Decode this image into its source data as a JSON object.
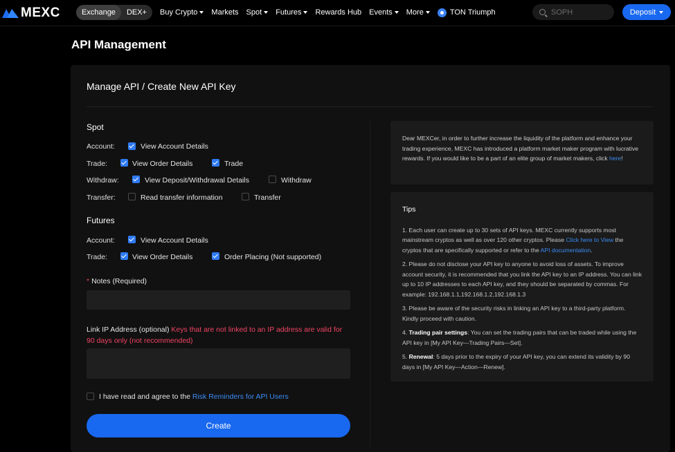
{
  "nav": {
    "logo": "MEXC",
    "switch": [
      "Exchange",
      "DEX+"
    ],
    "menu": [
      {
        "label": "Buy Crypto",
        "caret": true
      },
      {
        "label": "Markets",
        "caret": false
      },
      {
        "label": "Spot",
        "caret": true
      },
      {
        "label": "Futures",
        "caret": true
      },
      {
        "label": "Rewards Hub",
        "caret": false
      },
      {
        "label": "Events",
        "caret": true
      },
      {
        "label": "More",
        "caret": true
      }
    ],
    "promo": "TON Triumph",
    "search_placeholder": "SOPH",
    "deposit": "Deposit"
  },
  "page_title": "API Management",
  "panel_title": "Manage API / Create New API Key",
  "spot": {
    "title": "Spot",
    "rows": [
      {
        "label": "Account:",
        "options": [
          {
            "label": "View Account Details",
            "checked": true
          }
        ]
      },
      {
        "label": "Trade:",
        "options": [
          {
            "label": "View Order Details",
            "checked": true
          },
          {
            "label": "Trade",
            "checked": true
          }
        ]
      },
      {
        "label": "Withdraw:",
        "options": [
          {
            "label": "View Deposit/Withdrawal Details",
            "checked": true
          },
          {
            "label": "Withdraw",
            "checked": false
          }
        ]
      },
      {
        "label": "Transfer:",
        "options": [
          {
            "label": "Read transfer information",
            "checked": false
          },
          {
            "label": "Transfer",
            "checked": false
          }
        ]
      }
    ]
  },
  "futures": {
    "title": "Futures",
    "rows": [
      {
        "label": "Account:",
        "options": [
          {
            "label": "View Account Details",
            "checked": true
          }
        ]
      },
      {
        "label": "Trade:",
        "options": [
          {
            "label": "View Order Details",
            "checked": true
          },
          {
            "label": "Order Placing (Not supported)",
            "checked": true
          }
        ]
      }
    ]
  },
  "notes": {
    "required_mark": "*",
    "label": "Notes (Required)",
    "value": ""
  },
  "ip": {
    "label": "Link IP Address (optional)",
    "warning_line1": "Keys that are not linked to an IP address are valid for",
    "warning_line2": "90 days only (not recommended)",
    "value": ""
  },
  "agree": {
    "text": "I have read and agree to the",
    "link": "Risk Reminders for API Users",
    "checked": false
  },
  "create": "Create",
  "notice": {
    "text": "Dear MEXCer, in order to further increase the liquidity of the platform and enhance your trading experience, MEXC has introduced a platform market maker program with lucrative rewards. If you would like to be a part of an elite group of market makers, click ",
    "link": "here",
    "end": "!"
  },
  "tips": {
    "title": "Tips",
    "t1_a": "1. Each user can create up to 30 sets of API keys. MEXC currently supports most mainstream cryptos as well as over 120 other cryptos. Please ",
    "t1_link1": "Click here to View",
    "t1_b": " the cryptos that are specifically supported or refer to the ",
    "t1_link2": "API documentation",
    "t1_c": ".",
    "t2": "2. Please do not disclose your API key to anyone to avoid loss of assets. To improve account security, it is recommended that you link the API key to an IP address. You can link up to 10 IP addresses to each API key, and they should be separated by commas. For example: 192.168.1.1,192.168.1.2,192.168.1.3",
    "t3": "3. Please be aware of the security risks in linking an API key to a third-party platform. Kindly proceed with caution.",
    "t4_num": "4. ",
    "t4_bold": "Trading pair settings",
    "t4_rest": ": You can set the trading pairs that can be traded while using the API key in [My API Key—Trading Pairs—Set].",
    "t5_num": "5. ",
    "t5_bold": "Renewal",
    "t5_rest": ": 5 days prior to the expiry of your API key, you can extend its validity by 90 days in [My API Key—Action—Renew]."
  }
}
